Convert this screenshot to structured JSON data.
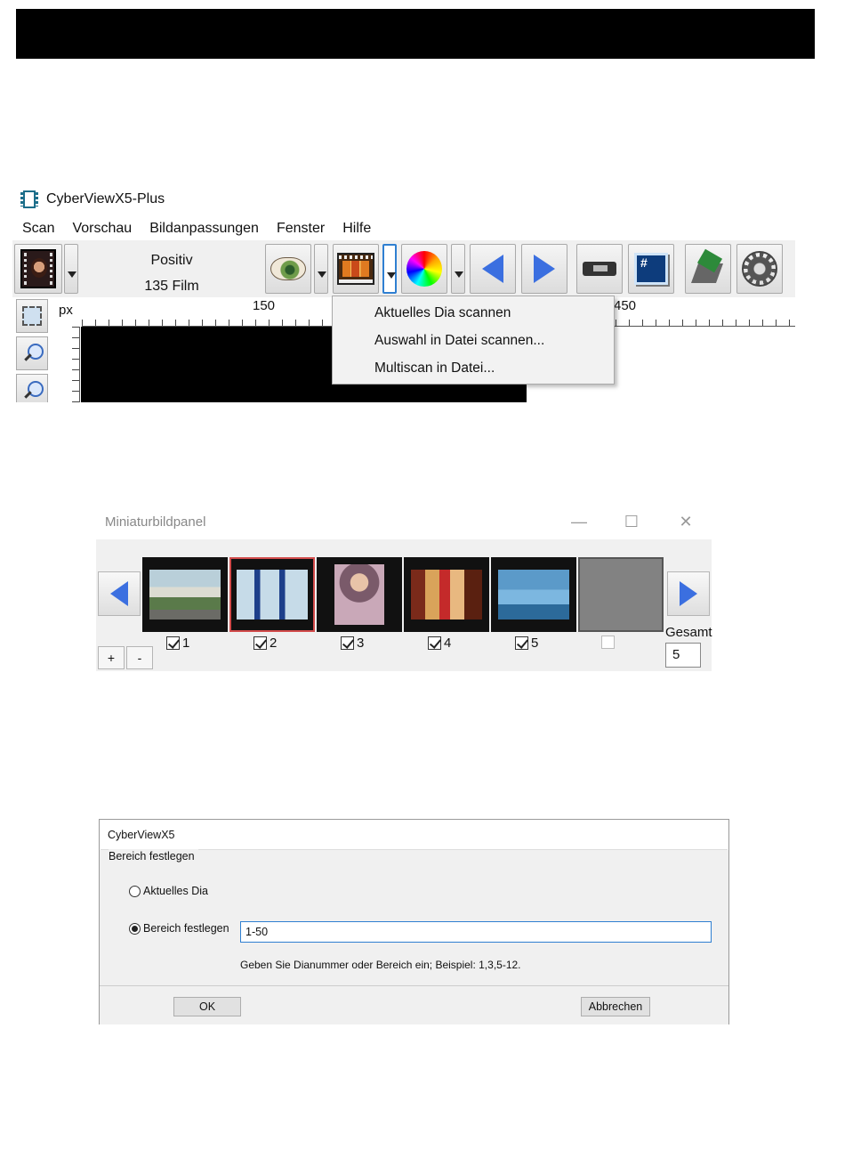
{
  "main_window": {
    "title": "CyberViewX5-Plus",
    "menu": [
      "Scan",
      "Vorschau",
      "Bildanpassungen",
      "Fenster",
      "Hilfe"
    ],
    "mode": {
      "line1": "Positiv",
      "line2": "135 Film"
    },
    "ruler": {
      "unit": "px",
      "labels": [
        "150",
        "450"
      ]
    },
    "scan_menu": [
      "Aktuelles Dia scannen",
      "Auswahl in Datei scannen...",
      "Multiscan in Datei..."
    ],
    "icons": {
      "thumbnail": "film-photo-icon",
      "preview": "eye-icon",
      "scan": "film-strip-icon",
      "color": "color-wheel-icon",
      "prev": "arrow-left-icon",
      "next": "arrow-right-icon",
      "device": "scanner-device-icon",
      "display": "monitor-icon",
      "clean": "broom-icon",
      "settings": "gear-icon"
    }
  },
  "thumbnail_panel": {
    "title": "Miniaturbildpanel",
    "controls": {
      "minimize": "—",
      "maximize": "☐",
      "close": "✕"
    },
    "slides": [
      {
        "label": "1",
        "checked": true,
        "selected": false
      },
      {
        "label": "2",
        "checked": true,
        "selected": true
      },
      {
        "label": "3",
        "checked": true,
        "selected": false
      },
      {
        "label": "4",
        "checked": true,
        "selected": false
      },
      {
        "label": "5",
        "checked": true,
        "selected": false
      },
      {
        "label": "",
        "checked": false,
        "selected": false
      }
    ],
    "plus_label": "+",
    "minus_label": "-",
    "gesamt_label": "Gesamt",
    "gesamt_value": "5"
  },
  "dialog": {
    "title": "CyberViewX5",
    "group_label": "Bereich festlegen",
    "option_current": "Aktuelles Dia",
    "option_range": "Bereich festlegen",
    "range_value": "1-50",
    "hint": "Geben Sie Dianummer oder Bereich ein; Beispiel: 1,3,5-12.",
    "ok_label": "OK",
    "cancel_label": "Abbrechen"
  }
}
